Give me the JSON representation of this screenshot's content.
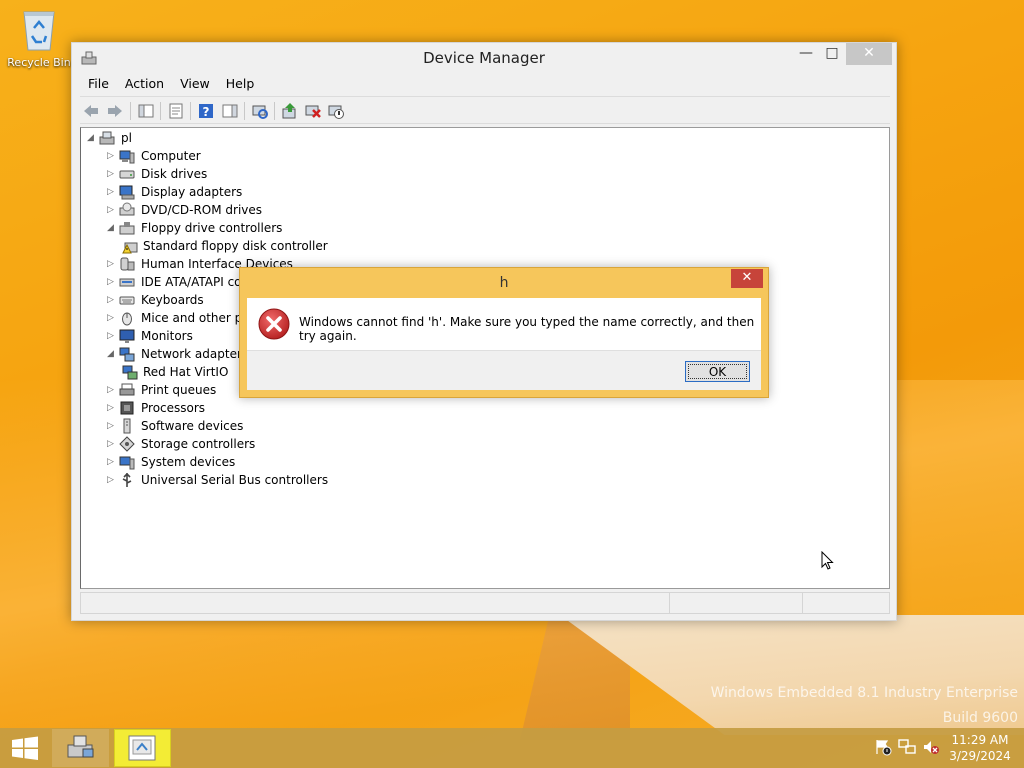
{
  "desktop": {
    "recycle_bin_label": "Recycle Bin",
    "watermark_line1": "Windows Embedded 8.1 Industry Enterprise",
    "watermark_line2": "Build 9600"
  },
  "window": {
    "title": "Device Manager",
    "controls": {
      "minimize": "—",
      "maximize": "□",
      "close": "✕"
    },
    "menu": [
      "File",
      "Action",
      "View",
      "Help"
    ]
  },
  "tree": {
    "root": "pl",
    "items": [
      {
        "label": "Computer",
        "expanded": false,
        "icon": "computer-icon"
      },
      {
        "label": "Disk drives",
        "expanded": false,
        "icon": "disk-icon"
      },
      {
        "label": "Display adapters",
        "expanded": false,
        "icon": "display-icon"
      },
      {
        "label": "DVD/CD-ROM drives",
        "expanded": false,
        "icon": "dvd-icon"
      },
      {
        "label": "Floppy drive controllers",
        "expanded": true,
        "icon": "floppy-controller-icon"
      },
      {
        "label": "Standard floppy disk controller",
        "child": true,
        "icon": "floppy-warning-icon"
      },
      {
        "label": "Human Interface Devices",
        "expanded": false,
        "icon": "hid-icon"
      },
      {
        "label": "IDE ATA/ATAPI co",
        "expanded": false,
        "icon": "ide-icon"
      },
      {
        "label": "Keyboards",
        "expanded": false,
        "icon": "keyboard-icon"
      },
      {
        "label": "Mice and other po",
        "expanded": false,
        "icon": "mouse-icon"
      },
      {
        "label": "Monitors",
        "expanded": false,
        "icon": "monitor-icon"
      },
      {
        "label": "Network adapters",
        "expanded": true,
        "icon": "network-icon"
      },
      {
        "label": "Red Hat VirtIO",
        "child": true,
        "icon": "network-adapter-icon"
      },
      {
        "label": "Print queues",
        "expanded": false,
        "icon": "printer-icon"
      },
      {
        "label": "Processors",
        "expanded": false,
        "icon": "processor-icon"
      },
      {
        "label": "Software devices",
        "expanded": false,
        "icon": "software-device-icon"
      },
      {
        "label": "Storage controllers",
        "expanded": false,
        "icon": "storage-icon"
      },
      {
        "label": "System devices",
        "expanded": false,
        "icon": "system-icon"
      },
      {
        "label": "Universal Serial Bus controllers",
        "expanded": false,
        "icon": "usb-icon"
      }
    ]
  },
  "dialog": {
    "title": "h",
    "close": "✕",
    "message": "Windows cannot find 'h'. Make sure you typed the name correctly, and then try again.",
    "ok_label": "OK"
  },
  "taskbar": {
    "time": "11:29 AM",
    "date": "3/29/2024"
  },
  "colors": {
    "desktop": "#f6a410",
    "dialog_frame": "#f6c65b",
    "dialog_close": "#c7443a",
    "error_red": "#d23a3a"
  }
}
